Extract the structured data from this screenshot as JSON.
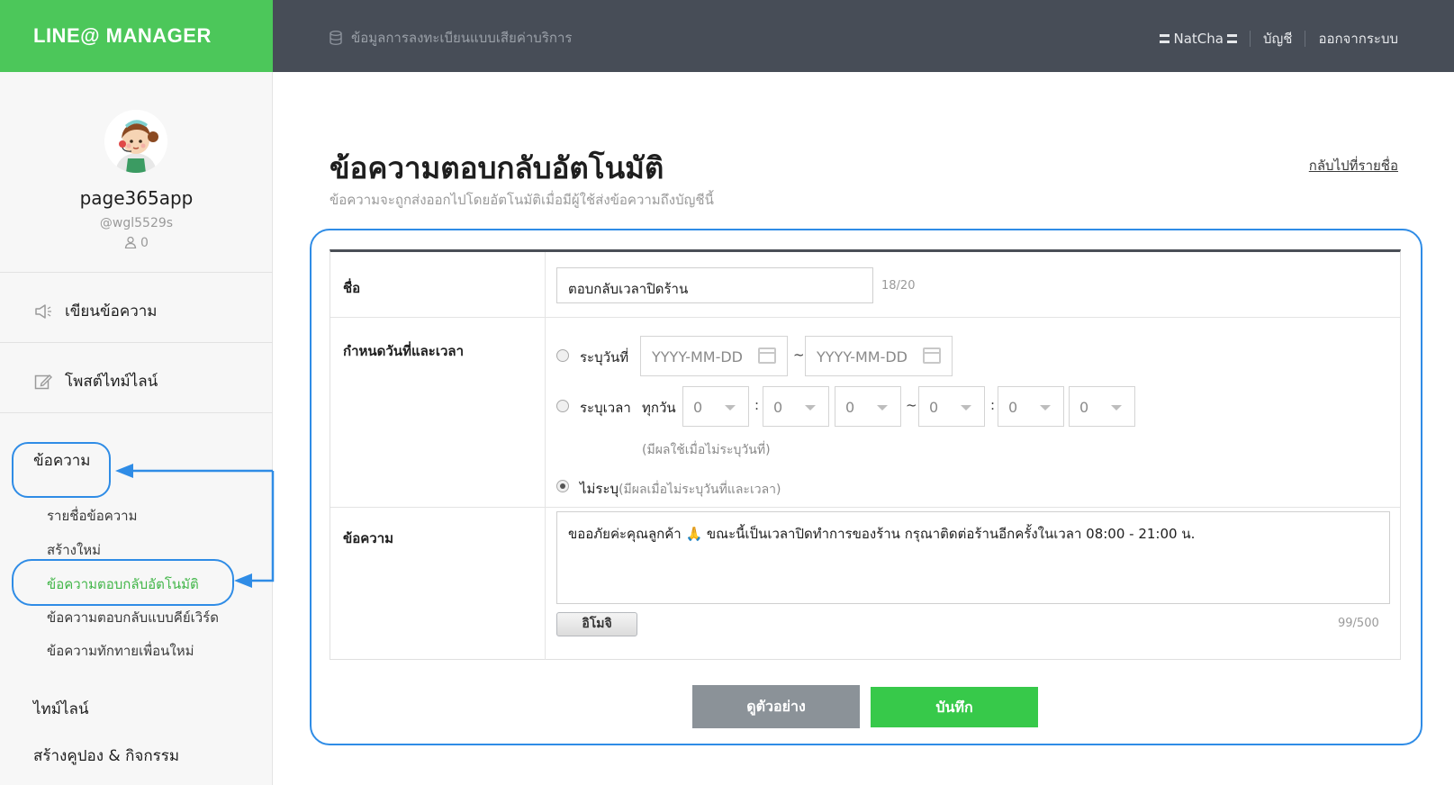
{
  "app": {
    "brand": "LINE@ MANAGER"
  },
  "topbar": {
    "billing_link": "ข้อมูลการลงทะเบียนแบบเสียค่าบริการ",
    "user": "NatCha",
    "account_link": "บัญชี",
    "logout_link": "ออกจากระบบ"
  },
  "profile": {
    "name": "page365app",
    "id": "@wgl5529s",
    "friends_count": "0"
  },
  "sidebar": {
    "write_message": "เขียนข้อความ",
    "post_timeline": "โพสต์ไทม์ไลน์",
    "messages_section": "ข้อความ",
    "sub_items": [
      {
        "label": "รายชื่อข้อความ"
      },
      {
        "label": "สร้างใหม่"
      },
      {
        "label": "ข้อความตอบกลับอัตโนมัติ"
      },
      {
        "label": "ข้อความตอบกลับแบบคีย์เวิร์ด"
      },
      {
        "label": "ข้อความทักทายเพื่อนใหม่"
      }
    ],
    "timeline": "ไทม์ไลน์",
    "coupons": "สร้างคูปอง & กิจกรรม"
  },
  "page": {
    "title": "ข้อความตอบกลับอัตโนมัติ",
    "subtitle": "ข้อความจะถูกส่งออกไปโดยอัตโนมัติเมื่อมีผู้ใช้ส่งข้อความถึงบัญชีนี้",
    "back_link": "กลับไปที่รายชื่อ"
  },
  "form": {
    "name_label": "ชื่อ",
    "name_value": "ตอบกลับเวลาปิดร้าน",
    "name_counter": "18/20",
    "schedule_label": "กำหนดวันที่และเวลา",
    "date_option": "ระบุวันที่",
    "date_start_placeholder": "YYYY-MM-DD",
    "date_end_placeholder": "YYYY-MM-DD",
    "date_range_sep": "~",
    "time_option": "ระบุเวลา",
    "time_every_day": "ทุกวัน",
    "time_colon": ":",
    "time_range_sep": "~",
    "time_selects": [
      "0",
      "0",
      "0",
      "0",
      "0",
      "0"
    ],
    "time_hint": "(มีผลใช้เมื่อไม่ระบุวันที่)",
    "none_option": "ไม่ระบุ",
    "none_hint": "(มีผลเมื่อไม่ระบุวันที่และเวลา)",
    "selected_option": "none",
    "message_label": "ข้อความ",
    "message_value": "ขออภัยค่ะคุณลูกค้า 🙏 ขณะนี้เป็นเวลาปิดทำการของร้าน กรุณาติดต่อร้านอีกครั้งในเวลา 08:00 - 21:00 น.",
    "emoji_button": "อิโมจิ",
    "message_counter": "99/500"
  },
  "actions": {
    "preview": "ดูตัวอย่าง",
    "save": "บันทึก"
  },
  "colors": {
    "brand_green": "#4cc75a",
    "topbar": "#474d57",
    "highlight_blue": "#2f8ce6",
    "save_green": "#37c94a",
    "preview_gray": "#8b9298"
  }
}
